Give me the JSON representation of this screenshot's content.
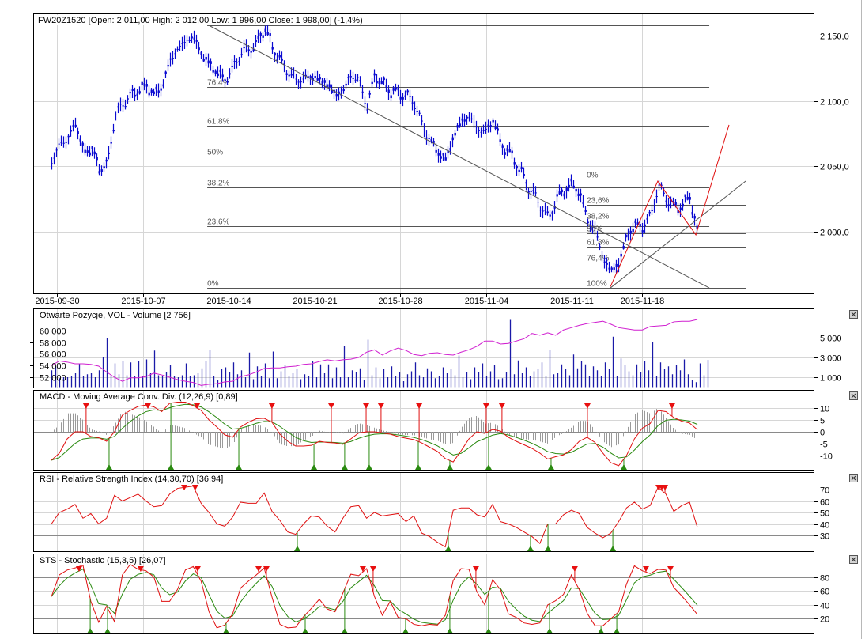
{
  "header": {
    "symbol_info": "FW20Z1520 [Open: 2 011,00  High: 2 012,00  Low: 1 996,00  Close: 1 998,00] (-1,4%)"
  },
  "x_axis": {
    "labels": [
      "2015-09-30",
      "2015-10-07",
      "2015-10-14",
      "2015-10-21",
      "2015-10-28",
      "2015-11-04",
      "2015-11-11",
      "2015-11-18"
    ],
    "label_days": [
      0,
      5,
      10,
      15,
      20,
      25,
      30,
      34.1
    ],
    "sample_day_range": [
      -0.32,
      37.33
    ]
  },
  "chart_data": [
    {
      "type": "line",
      "name": "price",
      "title": "FW20Z1520",
      "ylim": [
        1953,
        2170
      ],
      "y_ticks": [
        2150,
        2100,
        2050,
        2000
      ],
      "y_tick_labels": [
        "2 150,0",
        "2 100,0",
        "2 050,0",
        "2 000,0"
      ],
      "close": [
        2052,
        2068,
        2070,
        2084,
        2061,
        2064,
        2049,
        2050,
        2088,
        2098,
        2104,
        2108,
        2112,
        2105,
        2111,
        2131,
        2140,
        2146,
        2149,
        2136,
        2128,
        2122,
        2116,
        2125,
        2137,
        2140,
        2143,
        2157,
        2141,
        2131,
        2122,
        2116,
        2117,
        2119,
        2116,
        2113,
        2104,
        2108,
        2120,
        2116,
        2095,
        2120,
        2113,
        2108,
        2106,
        2104,
        2099,
        2082,
        2070,
        2061,
        2055,
        2073,
        2085,
        2088,
        2079,
        2076,
        2086,
        2067,
        2061,
        2052,
        2040,
        2030,
        2021,
        2010,
        2024,
        2032,
        2036,
        2030,
        2009,
        2001,
        1979,
        1970,
        1976,
        1997,
        2005,
        2004,
        2012,
        2035,
        2026,
        2019,
        2020,
        2027,
        1998
      ],
      "fibonacci": [
        {
          "high": 2158,
          "low": 1957,
          "day_from": 8.76,
          "day_to": 38.02,
          "direction": "up",
          "levels": [
            1,
            0.764,
            0.618,
            0.5,
            0.382,
            0.236,
            0
          ],
          "labels": [
            "100%",
            "76,4%",
            "61,8%",
            "50%",
            "38,2%",
            "23,6%",
            "0%"
          ]
        },
        {
          "high": 2040,
          "low": 1957,
          "day_from": 30.88,
          "day_to": 40.14,
          "direction": "down",
          "levels": [
            0,
            0.236,
            0.382,
            0.5,
            0.618,
            0.764,
            1
          ],
          "labels": [
            "0%",
            "23,6%",
            "38,2%",
            "50%",
            "61,8%",
            "76,4%",
            "100%"
          ]
        }
      ],
      "trend_lines": [
        {
          "points": [
            [
              8.76,
              2158.5
            ],
            [
              38.02,
              1957
            ]
          ],
          "color": "#555555"
        },
        {
          "points": [
            [
              32.26,
              1957
            ],
            [
              40.14,
              2038.7
            ]
          ],
          "color": "#555555"
        },
        {
          "points": [
            [
              32.26,
              1958
            ],
            [
              35.02,
              2038.7
            ],
            [
              37.24,
              1997.6
            ],
            [
              39.17,
              2081.7
            ]
          ],
          "color": "#e01010"
        }
      ]
    },
    {
      "type": "bar",
      "name": "volume",
      "title": "Otwarte Pozycje, VOL - Volume [2 756]",
      "last_value": 2756,
      "y_ticks": [
        5000,
        3000,
        1000
      ],
      "y_tick_labels": [
        "5 000",
        "3 000",
        "1 000"
      ],
      "oi_ticks": [
        60000,
        58000,
        56000,
        54000,
        52000
      ],
      "oi_tick_labels": [
        "60 000",
        "58 000",
        "56 000",
        "54 000",
        "52 000"
      ],
      "volume": [
        1700,
        2100,
        900,
        1000,
        1000,
        1100,
        1400,
        2400,
        1100,
        1300,
        1400,
        1000,
        1700,
        3000,
        5000,
        1200,
        2400,
        1300,
        2600,
        1200,
        2500,
        1100,
        2600,
        1100,
        2800,
        1400,
        3700,
        1200,
        1100,
        1500,
        2200,
        1100,
        1000,
        1200,
        2400,
        1100,
        1200,
        1400,
        1900,
        2600,
        3800,
        1100,
        700,
        1800,
        2000,
        1500,
        2500,
        1300,
        1700,
        1000,
        3500,
        800,
        2100,
        1100,
        2400,
        900,
        3600,
        900,
        1600,
        2200,
        1100,
        1400,
        1800,
        800,
        1300,
        1100,
        2600,
        1000,
        2300,
        1400,
        2300,
        900,
        2000,
        1000,
        4200,
        1000,
        1700,
        1500,
        1900,
        700,
        4800,
        1200,
        2000,
        900,
        1800,
        1000,
        2100,
        1100,
        1500,
        600,
        1300,
        1600,
        2500,
        1200,
        1000,
        1900,
        1600,
        900,
        1100,
        2000,
        1400,
        1800,
        1200,
        3200,
        1000,
        1500,
        800,
        2000,
        1500,
        2400,
        1100,
        1600,
        2200,
        800,
        900,
        1500,
        6800,
        1300,
        2700,
        1400,
        2000,
        1100,
        1600,
        1800,
        2500,
        1100,
        3800,
        1300,
        1400,
        2300,
        1800,
        1200,
        3300,
        1900,
        2600,
        2300,
        1100,
        2100,
        1700,
        1100,
        2500,
        1800,
        5100,
        1100,
        2900,
        2200,
        1600,
        1200,
        2300,
        1500,
        2600,
        1700,
        4600,
        1100,
        2500,
        1800,
        2100,
        1300,
        2200,
        1700,
        2800,
        1300,
        700,
        500,
        2400,
        1200,
        2756
      ],
      "open_interest": [
        54000,
        54800,
        54600,
        54300,
        54300,
        54200,
        53900,
        52900,
        52000,
        51300,
        51900,
        51900,
        52100,
        52700,
        52400,
        52000,
        51600,
        51300,
        51100,
        50600,
        50800,
        50900,
        51200,
        51300,
        52100,
        52400,
        52900,
        53500,
        53600,
        53600,
        53800,
        53900,
        54200,
        54300,
        54700,
        55000,
        54800,
        55000,
        55100,
        55400,
        56300,
        56700,
        55800,
        56500,
        57000,
        56600,
        55900,
        55700,
        56100,
        56200,
        55900,
        55800,
        56300,
        56700,
        57300,
        58200,
        58200,
        57700,
        57800,
        58200,
        58600,
        59500,
        59200,
        59600,
        59200,
        60100,
        60500,
        60900,
        61200,
        61400,
        61600,
        61100,
        60500,
        60300,
        60100,
        60100,
        60700,
        60800,
        60900,
        61500,
        61600,
        61600,
        61900
      ],
      "colors": {
        "volume": "#1a1aa8",
        "open_interest": "#d020d0"
      }
    },
    {
      "type": "line",
      "name": "macd",
      "title": "MACD - Moving Average Conv. Div. (12,26,9) [0,89]",
      "y_ticks": [
        10,
        5,
        0,
        -5,
        -10
      ],
      "y_tick_labels": [
        "10",
        "5",
        "0",
        "-5",
        "-10"
      ],
      "macd": [
        -12,
        -9,
        -3,
        0,
        0,
        -2,
        -2.5,
        -4,
        0,
        7,
        9,
        10.7,
        11.3,
        10.5,
        8.5,
        12,
        12.5,
        12.5,
        11,
        9,
        5,
        2,
        -1.3,
        -2.3,
        2,
        4,
        5.5,
        5.7,
        4,
        -1,
        -4,
        -6,
        -6,
        -5.7,
        -4,
        -4.5,
        -4.7,
        -5.3,
        -3,
        -0.5,
        0,
        0,
        -0.5,
        -1,
        -2,
        -2.7,
        -3.3,
        -4.7,
        -6.5,
        -8.3,
        -11.3,
        -12.7,
        -8,
        -3,
        0,
        -0.7,
        1,
        0.3,
        -2.3,
        -4,
        -5.5,
        -7,
        -9,
        -11.5,
        -10.5,
        -9.7,
        -7.5,
        -4,
        -2.3,
        -4.5,
        -9,
        -13,
        -14.3,
        -10,
        -3,
        1.5,
        3.5,
        9,
        8.5,
        6,
        4.5,
        3.7,
        0.89
      ],
      "sell_signal_days": [
        1.7,
        5.3,
        8.16,
        12.53,
        15.99,
        18.02,
        18.89,
        21.11,
        25.02,
        25.94,
        30.92,
        35.85
      ],
      "buy_signal_days": [
        3.04,
        6.64,
        10.6,
        14.98,
        16.77,
        18.2,
        21.06,
        22.9,
        25.16,
        28.8,
        33.04
      ]
    },
    {
      "type": "line",
      "name": "rsi",
      "title": "RSI - Relative Strength Index (14,30,70) [36,94]",
      "y_ticks": [
        70,
        60,
        50,
        40,
        30
      ],
      "y_tick_labels": [
        "70",
        "60",
        "50",
        "40",
        "30"
      ],
      "rsi": [
        40,
        50,
        53,
        57,
        45,
        49,
        40,
        45,
        65,
        60,
        63,
        66,
        60,
        55,
        56,
        66,
        71,
        72,
        73,
        58,
        50,
        40,
        38,
        46,
        59,
        58,
        58,
        67,
        51,
        43,
        33,
        31,
        40,
        47,
        46,
        38,
        33,
        45,
        55,
        56,
        45,
        50,
        47,
        48,
        49,
        42,
        47,
        32,
        29,
        24,
        20,
        52,
        54,
        54,
        48,
        46,
        57,
        42,
        40,
        37,
        33,
        29,
        23,
        40,
        40,
        48,
        52,
        49,
        37,
        32,
        28,
        32,
        42,
        54,
        59,
        53,
        56,
        72,
        66,
        51,
        56,
        59,
        36.94
      ],
      "sell_signal_days": [
        7.42,
        8.06,
        35.07,
        35.25,
        35.44
      ],
      "buy_signal_days": [
        14.01,
        22.81,
        27.6,
        28.62,
        32.4
      ]
    },
    {
      "type": "line",
      "name": "stochastic",
      "title": "STS - Stochastic (15,3,5) [26,07]",
      "y_ticks": [
        80,
        60,
        40,
        20
      ],
      "y_tick_labels": [
        "80",
        "60",
        "40",
        "20"
      ],
      "k": [
        52,
        83,
        90,
        93,
        97,
        45,
        15,
        38,
        16,
        83,
        98,
        91,
        89,
        80,
        45,
        45,
        62,
        90,
        95,
        74,
        30,
        7,
        11,
        27,
        64,
        74,
        83,
        93,
        51,
        12,
        7,
        8,
        23,
        35,
        48,
        34,
        30,
        57,
        84,
        82,
        92,
        52,
        25,
        45,
        22,
        20,
        12,
        10,
        12,
        11,
        25,
        75,
        92,
        91,
        59,
        40,
        76,
        62,
        27,
        22,
        14,
        12,
        14,
        40,
        46,
        55,
        83,
        62,
        28,
        10,
        10,
        20,
        30,
        70,
        96,
        89,
        85,
        91,
        90,
        65,
        53,
        40,
        26.07
      ],
      "sell_signal_days": [
        1.29,
        4.88,
        8.2,
        11.75,
        12.21,
        17.83,
        18.43,
        24.42,
        30.18,
        34.33,
        35.76
      ],
      "buy_signal_days": [
        1.94,
        2.95,
        9.86,
        14.47,
        16.77,
        20.32,
        22.9,
        25.16,
        28.71,
        31.71,
        32.63
      ]
    }
  ]
}
